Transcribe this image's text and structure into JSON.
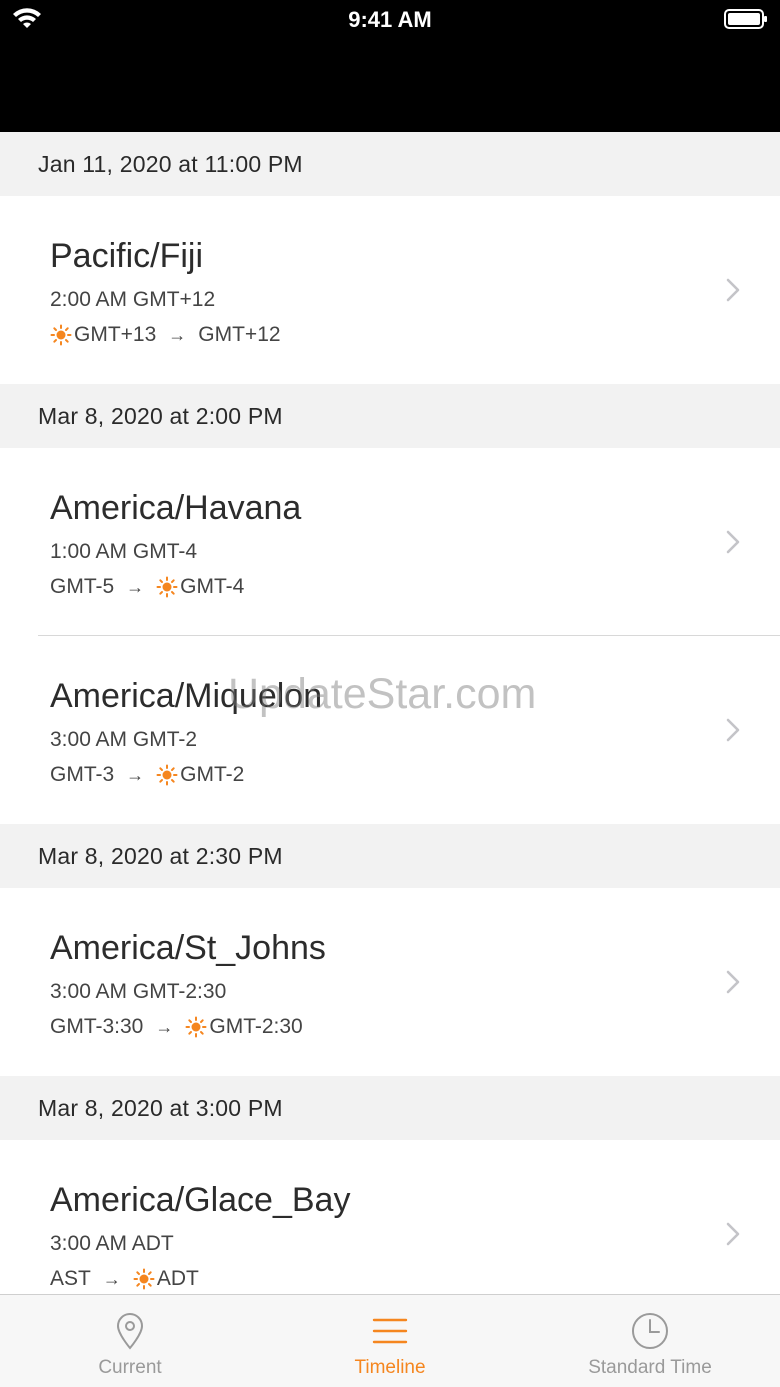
{
  "status_bar": {
    "time": "9:41 AM"
  },
  "sections": [
    {
      "header": "Jan 11, 2020 at 11:00 PM",
      "items": [
        {
          "name": "Pacific/Fiji",
          "time": "2:00 AM GMT+12",
          "from": "GMT+13",
          "to": "GMT+12",
          "from_dst": true,
          "to_dst": false
        }
      ]
    },
    {
      "header": "Mar 8, 2020 at 2:00 PM",
      "items": [
        {
          "name": "America/Havana",
          "time": "1:00 AM GMT-4",
          "from": "GMT-5",
          "to": "GMT-4",
          "from_dst": false,
          "to_dst": true
        },
        {
          "name": "America/Miquelon",
          "time": "3:00 AM GMT-2",
          "from": "GMT-3",
          "to": "GMT-2",
          "from_dst": false,
          "to_dst": true
        }
      ]
    },
    {
      "header": "Mar 8, 2020 at 2:30 PM",
      "items": [
        {
          "name": "America/St_Johns",
          "time": "3:00 AM GMT-2:30",
          "from": "GMT-3:30",
          "to": "GMT-2:30",
          "from_dst": false,
          "to_dst": true
        }
      ]
    },
    {
      "header": "Mar 8, 2020 at 3:00 PM",
      "items": [
        {
          "name": "America/Glace_Bay",
          "time": "3:00 AM ADT",
          "from": "AST",
          "to": "ADT",
          "from_dst": false,
          "to_dst": true
        }
      ]
    }
  ],
  "watermark": "UpdateStar.com",
  "tabs": [
    {
      "label": "Current",
      "icon": "location-pin-icon",
      "active": false
    },
    {
      "label": "Timeline",
      "icon": "list-lines-icon",
      "active": true
    },
    {
      "label": "Standard Time",
      "icon": "clock-icon",
      "active": false
    }
  ],
  "colors": {
    "accent": "#f5861f",
    "section_bg": "#f2f2f2",
    "inactive_tab": "#9a9a9a"
  }
}
